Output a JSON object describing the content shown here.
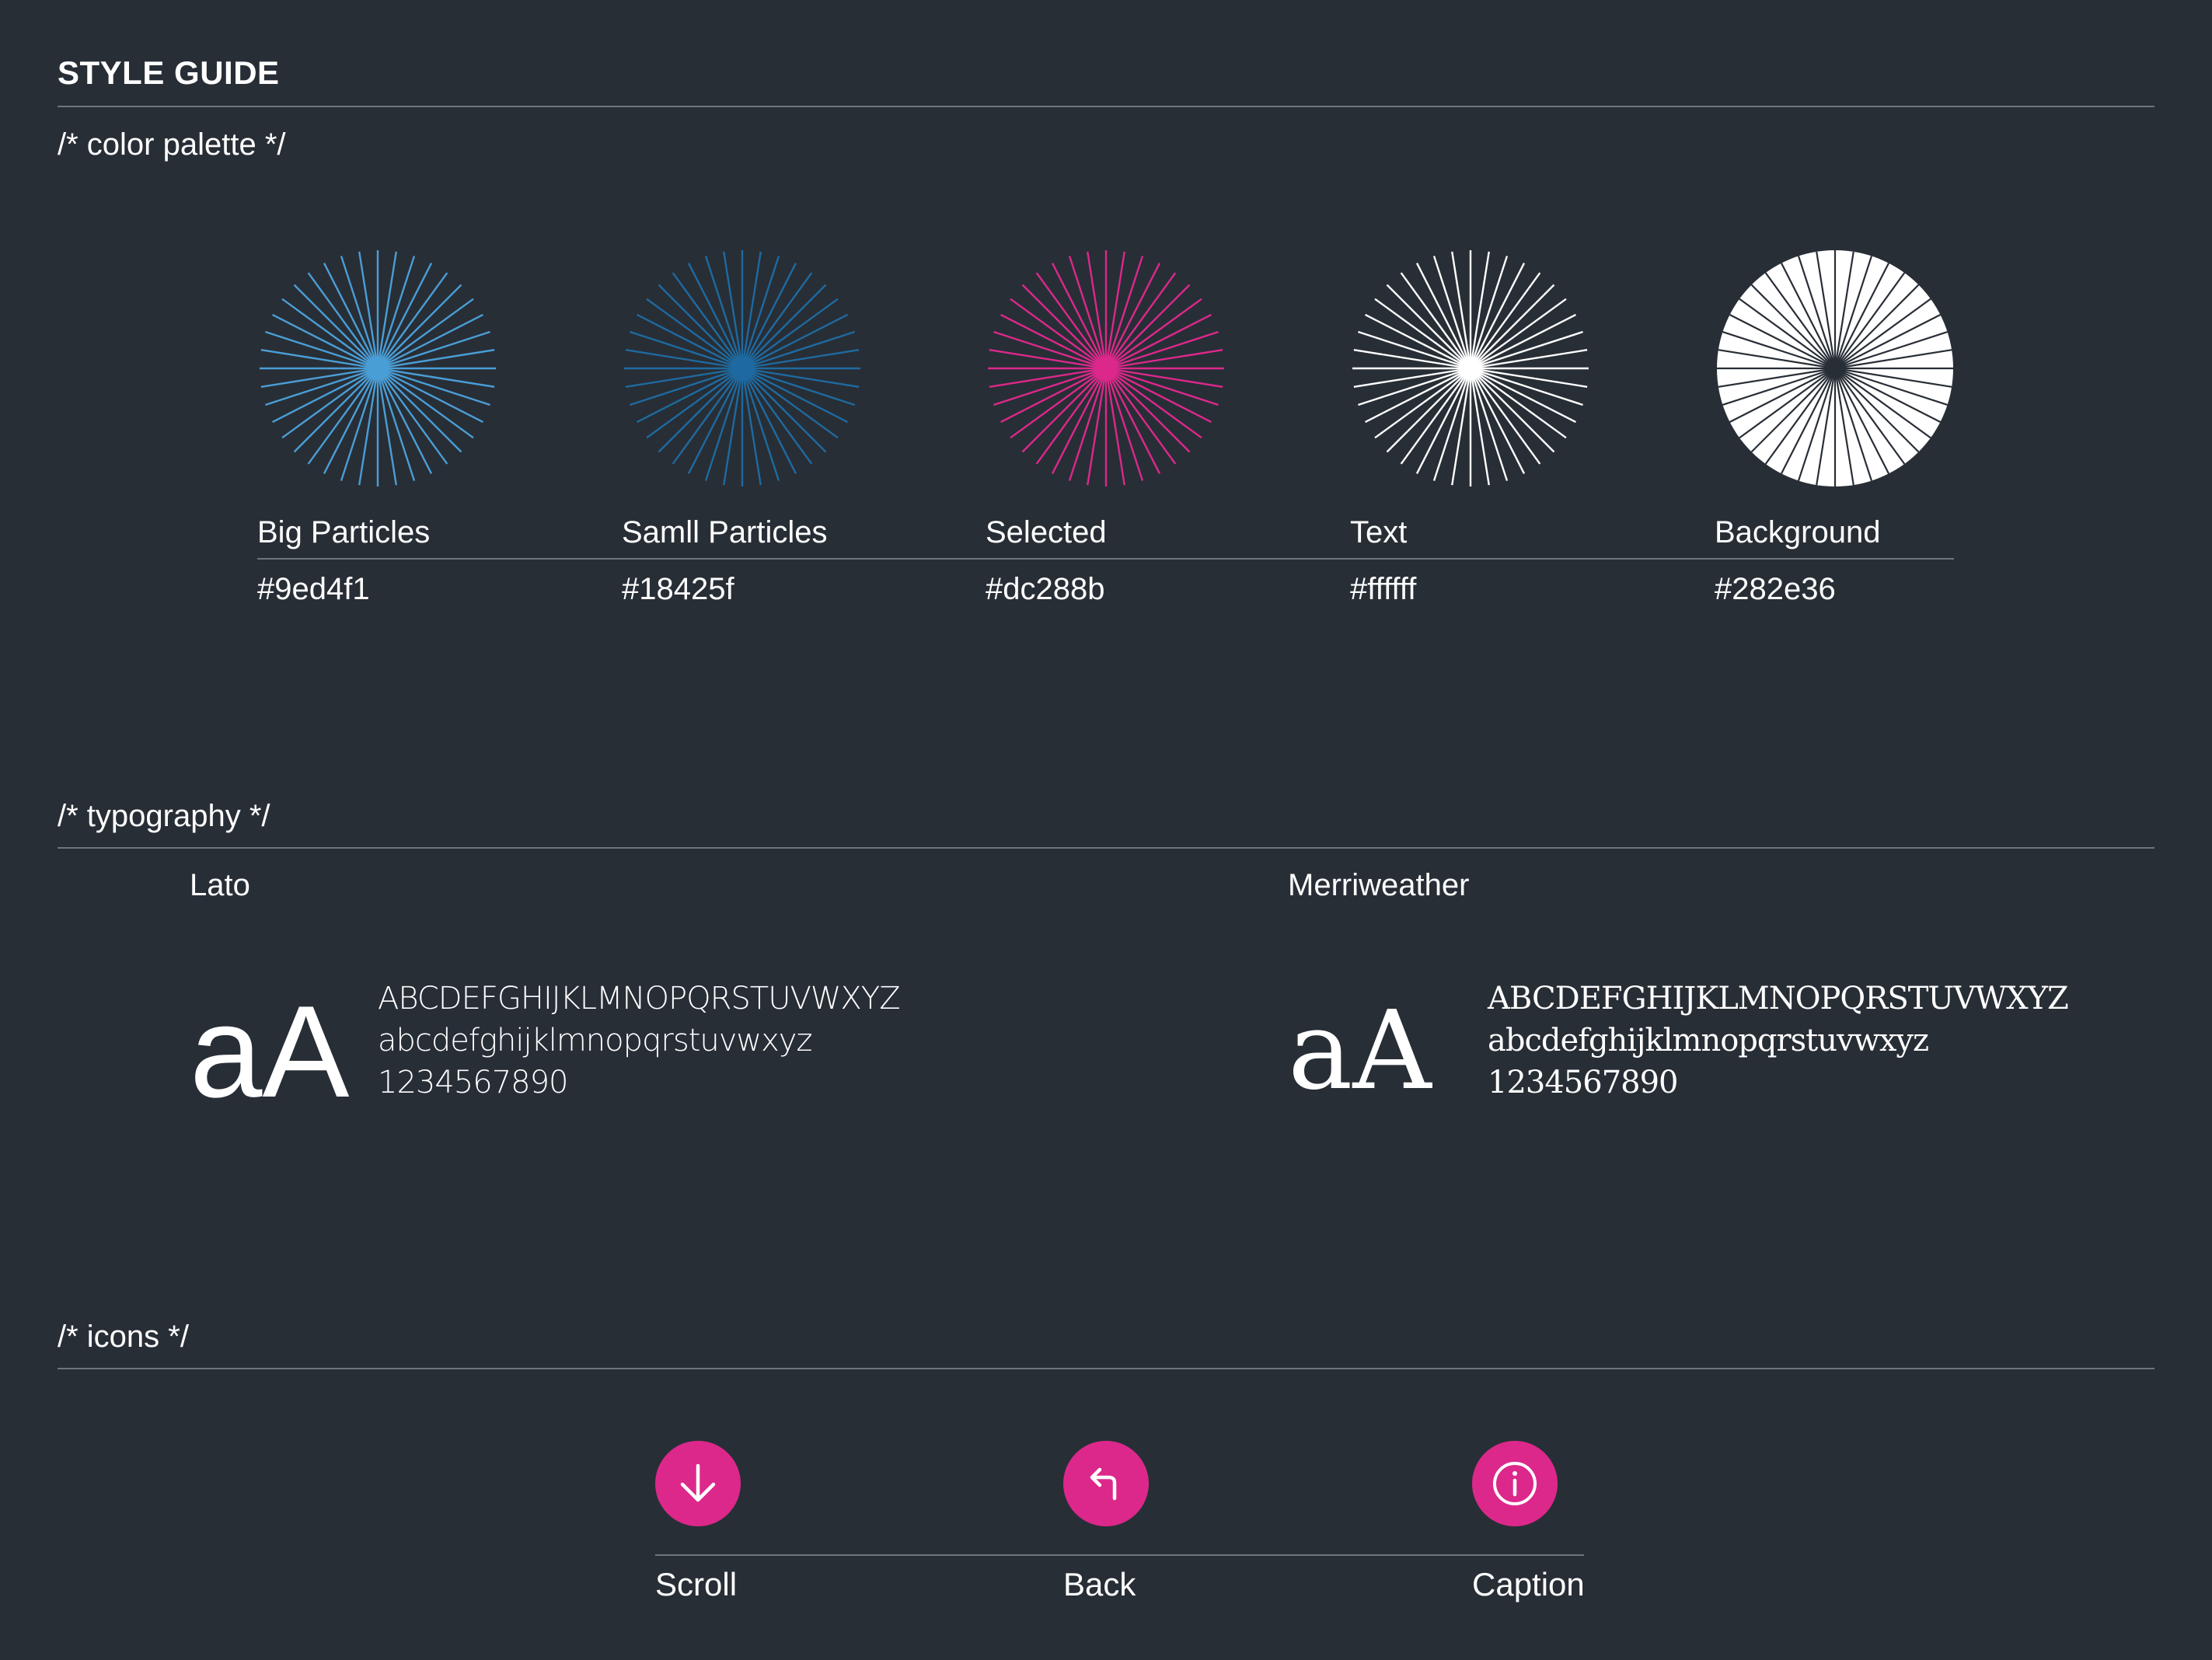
{
  "header": {
    "title": "STYLE GUIDE"
  },
  "color_palette": {
    "label": "/* color palette */",
    "swatches": [
      {
        "name": "Big Particles",
        "hex": "#9ed4f1",
        "color": "#4a9ed6"
      },
      {
        "name": "Samll Particles",
        "hex": "#18425f",
        "color": "#1e6aa0"
      },
      {
        "name": "Selected",
        "hex": "#dc288b",
        "color": "#dc288b"
      },
      {
        "name": "Text",
        "hex": "#ffffff",
        "color": "#ffffff"
      },
      {
        "name": "Background",
        "hex": "#282e36",
        "color": "#282e36"
      }
    ]
  },
  "typography": {
    "label": "/* typography */",
    "fonts": [
      {
        "name": "Lato",
        "sample": "aA",
        "uppercase": "ABCDEFGHIJKLMNOPQRSTUVWXYZ",
        "lowercase": "abcdefghijklmnopqrstuvwxyz",
        "digits": "1234567890"
      },
      {
        "name": "Merriweather",
        "sample": "aA",
        "uppercase": "ABCDEFGHIJKLMNOPQRSTUVWXYZ",
        "lowercase": "abcdefghijklmnopqrstuvwxyz",
        "digits": "1234567890"
      }
    ]
  },
  "icons": {
    "label": "/* icons */",
    "accent": "#dc288b",
    "items": [
      {
        "name": "Scroll",
        "icon": "arrow-down-icon"
      },
      {
        "name": "Back",
        "icon": "back-arrow-icon"
      },
      {
        "name": "Caption",
        "icon": "info-icon"
      }
    ]
  }
}
